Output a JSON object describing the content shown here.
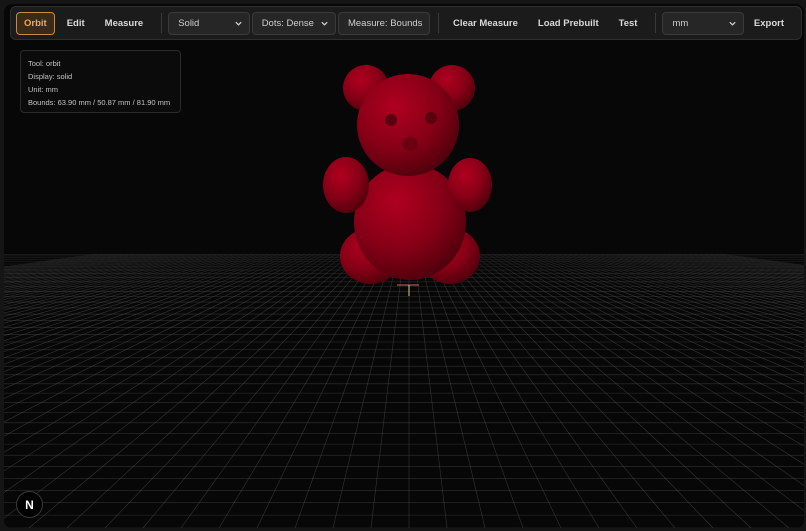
{
  "toolbar": {
    "tools": [
      {
        "label": "Orbit",
        "active": true
      },
      {
        "label": "Edit",
        "active": false
      },
      {
        "label": "Measure",
        "active": false
      }
    ],
    "display_select": "Solid",
    "dots_select": "Dots: Dense",
    "measure_select": "Measure: Bounds",
    "clear_measure": "Clear Measure",
    "load_prebuilt": "Load Prebuilt",
    "test": "Test",
    "unit_select": "mm",
    "export": "Export"
  },
  "info": {
    "tool": "Tool: orbit",
    "display": "Display: solid",
    "unit": "Unit: mm",
    "bounds": "Bounds: 63.90 mm / 50.87 mm / 81.90 mm"
  },
  "badge": {
    "letter": "N"
  },
  "colors": {
    "accent": "#f1a851",
    "model": "#8b0018",
    "background": "#070707",
    "grid": "#5a5a5a"
  },
  "icons": {
    "dropdown": "chevron-down-icon",
    "badge": "n-logo-icon"
  }
}
